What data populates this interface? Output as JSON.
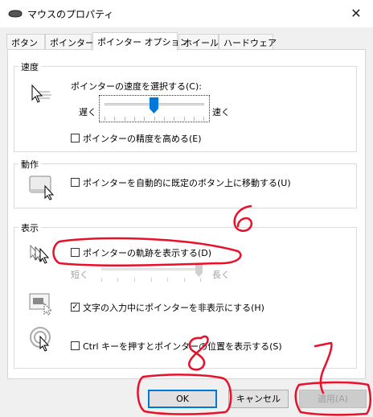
{
  "window": {
    "title": "マウスのプロパティ",
    "close_glyph": "✕"
  },
  "tabs": [
    {
      "label": "ボタン",
      "active": false
    },
    {
      "label": "ポインター",
      "active": false
    },
    {
      "label": "ポインター オプション",
      "active": true
    },
    {
      "label": "ホイール",
      "active": false
    },
    {
      "label": "ハードウェア",
      "active": false
    }
  ],
  "speed": {
    "group_label": "速度",
    "select_label": "ポインターの速度を選択する(C):",
    "slow": "遅く",
    "fast": "速く",
    "slider_level": 0.5,
    "precision_label": "ポインターの精度を高める(E)",
    "precision_checked": false
  },
  "snap": {
    "group_label": "動作",
    "label": "ポインターを自動的に既定のボタン上に移動する(U)",
    "checked": false
  },
  "visibility": {
    "group_label": "表示",
    "trails_label": "ポインターの軌跡を表示する(D)",
    "trails_checked": false,
    "short": "短く",
    "long": "長く",
    "trails_level": 1.0,
    "hide_label": "文字の入力中にポインターを非表示にする(H)",
    "hide_checked": true,
    "ctrl_label": "Ctrl キーを押すとポインターの位置を表示する(S)",
    "ctrl_checked": false
  },
  "buttons": {
    "ok": "OK",
    "cancel": "キャンセル",
    "apply": "適用(A)"
  },
  "annotations": {
    "six": "6",
    "seven": "7",
    "eight": "8"
  },
  "colors": {
    "annotation_red": "#e8102a",
    "default_button_border": "#0078d7",
    "slider_thumb": "#0078d7"
  },
  "icons": {
    "app": "mouse-icon",
    "speed": "pointer-speed-icon",
    "snap": "snap-to-button-icon",
    "trails": "pointer-trails-icon",
    "hide": "hide-pointer-icon",
    "ctrl": "locate-pointer-icon"
  }
}
